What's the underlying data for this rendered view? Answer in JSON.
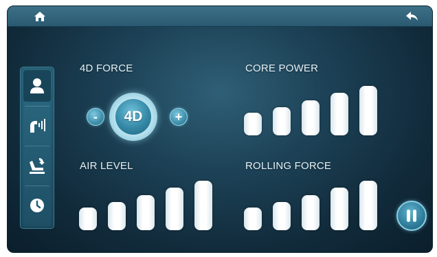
{
  "header": {
    "home_icon": "home-icon",
    "back_icon": "back-arrow-icon"
  },
  "sidebar": {
    "items": [
      {
        "icon": "person-icon",
        "active": true
      },
      {
        "icon": "arm-massage-icon",
        "active": false
      },
      {
        "icon": "recline-seat-icon",
        "active": false
      },
      {
        "icon": "clock-icon",
        "active": false
      }
    ]
  },
  "force4d": {
    "label": "4D FORCE",
    "minus_label": "-",
    "plus_label": "+",
    "badge_text": "4D"
  },
  "core_power": {
    "label": "CORE POWER",
    "levels": 5,
    "value": 5
  },
  "air_level": {
    "label": "AIR LEVEL",
    "levels": 5,
    "value": 5
  },
  "rolling_force": {
    "label": "ROLLING FORCE",
    "levels": 5,
    "value": 5
  },
  "controls": {
    "pause_icon": "pause-icon"
  },
  "colors": {
    "background": "#1d4257",
    "accent": "#3f8fab",
    "bar": "#ffffff"
  }
}
